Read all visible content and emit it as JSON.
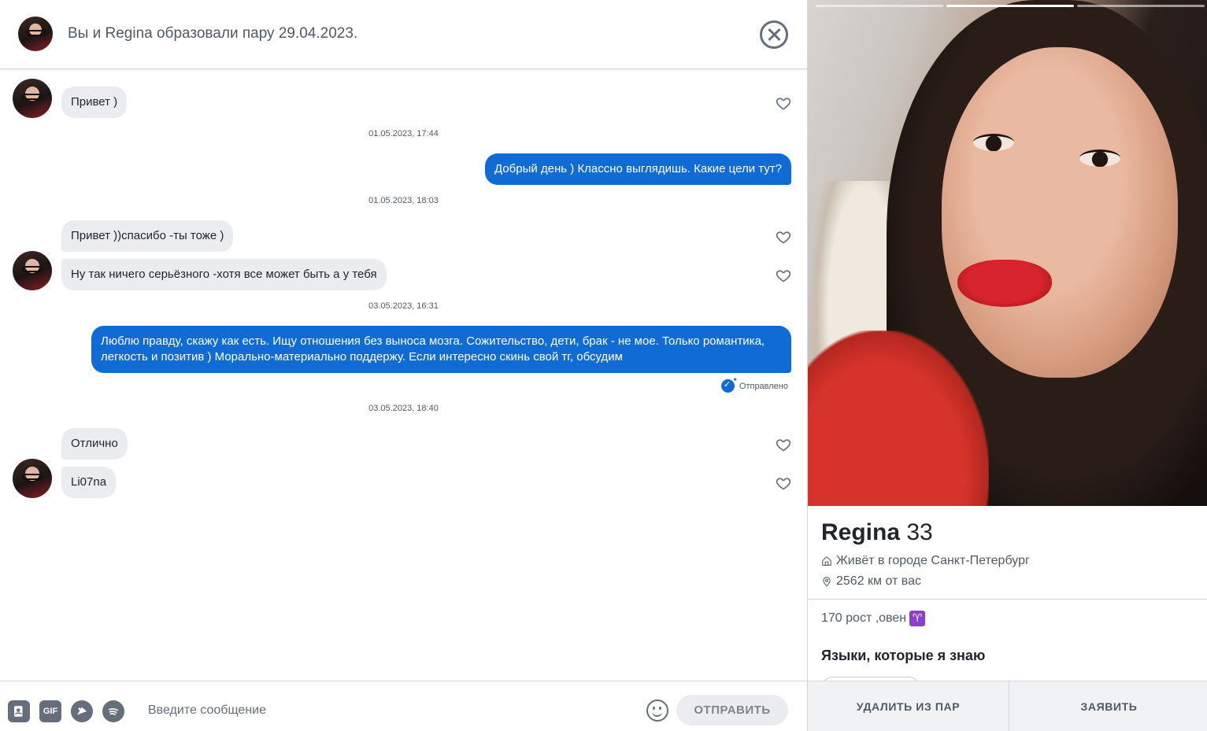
{
  "header": {
    "title": "Вы и Regina образовали пару 29.04.2023."
  },
  "messages": {
    "m1": "Привет )",
    "ts1": "01.05.2023, 17:44",
    "m2": "Добрый день ) Классно выглядишь. Какие цели тут?",
    "ts2": "01.05.2023, 18:03",
    "m3": "Привет ))спасибо -ты тоже )",
    "m4": "Ну так ничего серьёзного -хотя все может быть а у тебя",
    "ts3": "03.05.2023, 16:31",
    "m5": "Люблю правду, скажу как есть. Ищу отношения без выноса мозга. Сожительство, дети, брак - не мое. Только романтика, легкость и позитив ) Морально-материально поддержу. Если интересно скинь свой тг, обсудим",
    "status": "Отправлено",
    "ts4": "03.05.2023, 18:40",
    "m6": "Отлично",
    "m7": "Li07na"
  },
  "composer": {
    "placeholder": "Введите сообщение",
    "gif_label": "GIF",
    "send_label": "ОТПРАВИТЬ"
  },
  "profile": {
    "name": "Regina",
    "age": "33",
    "city": "Живёт в городе Санкт-Петербург",
    "distance": "2562 км от вас",
    "bio": "170 рост ,овен",
    "zodiac_glyph": "♈",
    "languages_title": "Языки, которые я знаю",
    "photo_count": 3,
    "active_photo": 2
  },
  "actions": {
    "unmatch_label": "УДАЛИТЬ ИЗ ПАР",
    "report_label": "ЗАЯВИТЬ"
  },
  "colors": {
    "accent": "#106bd5",
    "incoming_bubble": "#eaecef",
    "text_secondary": "#505965"
  }
}
